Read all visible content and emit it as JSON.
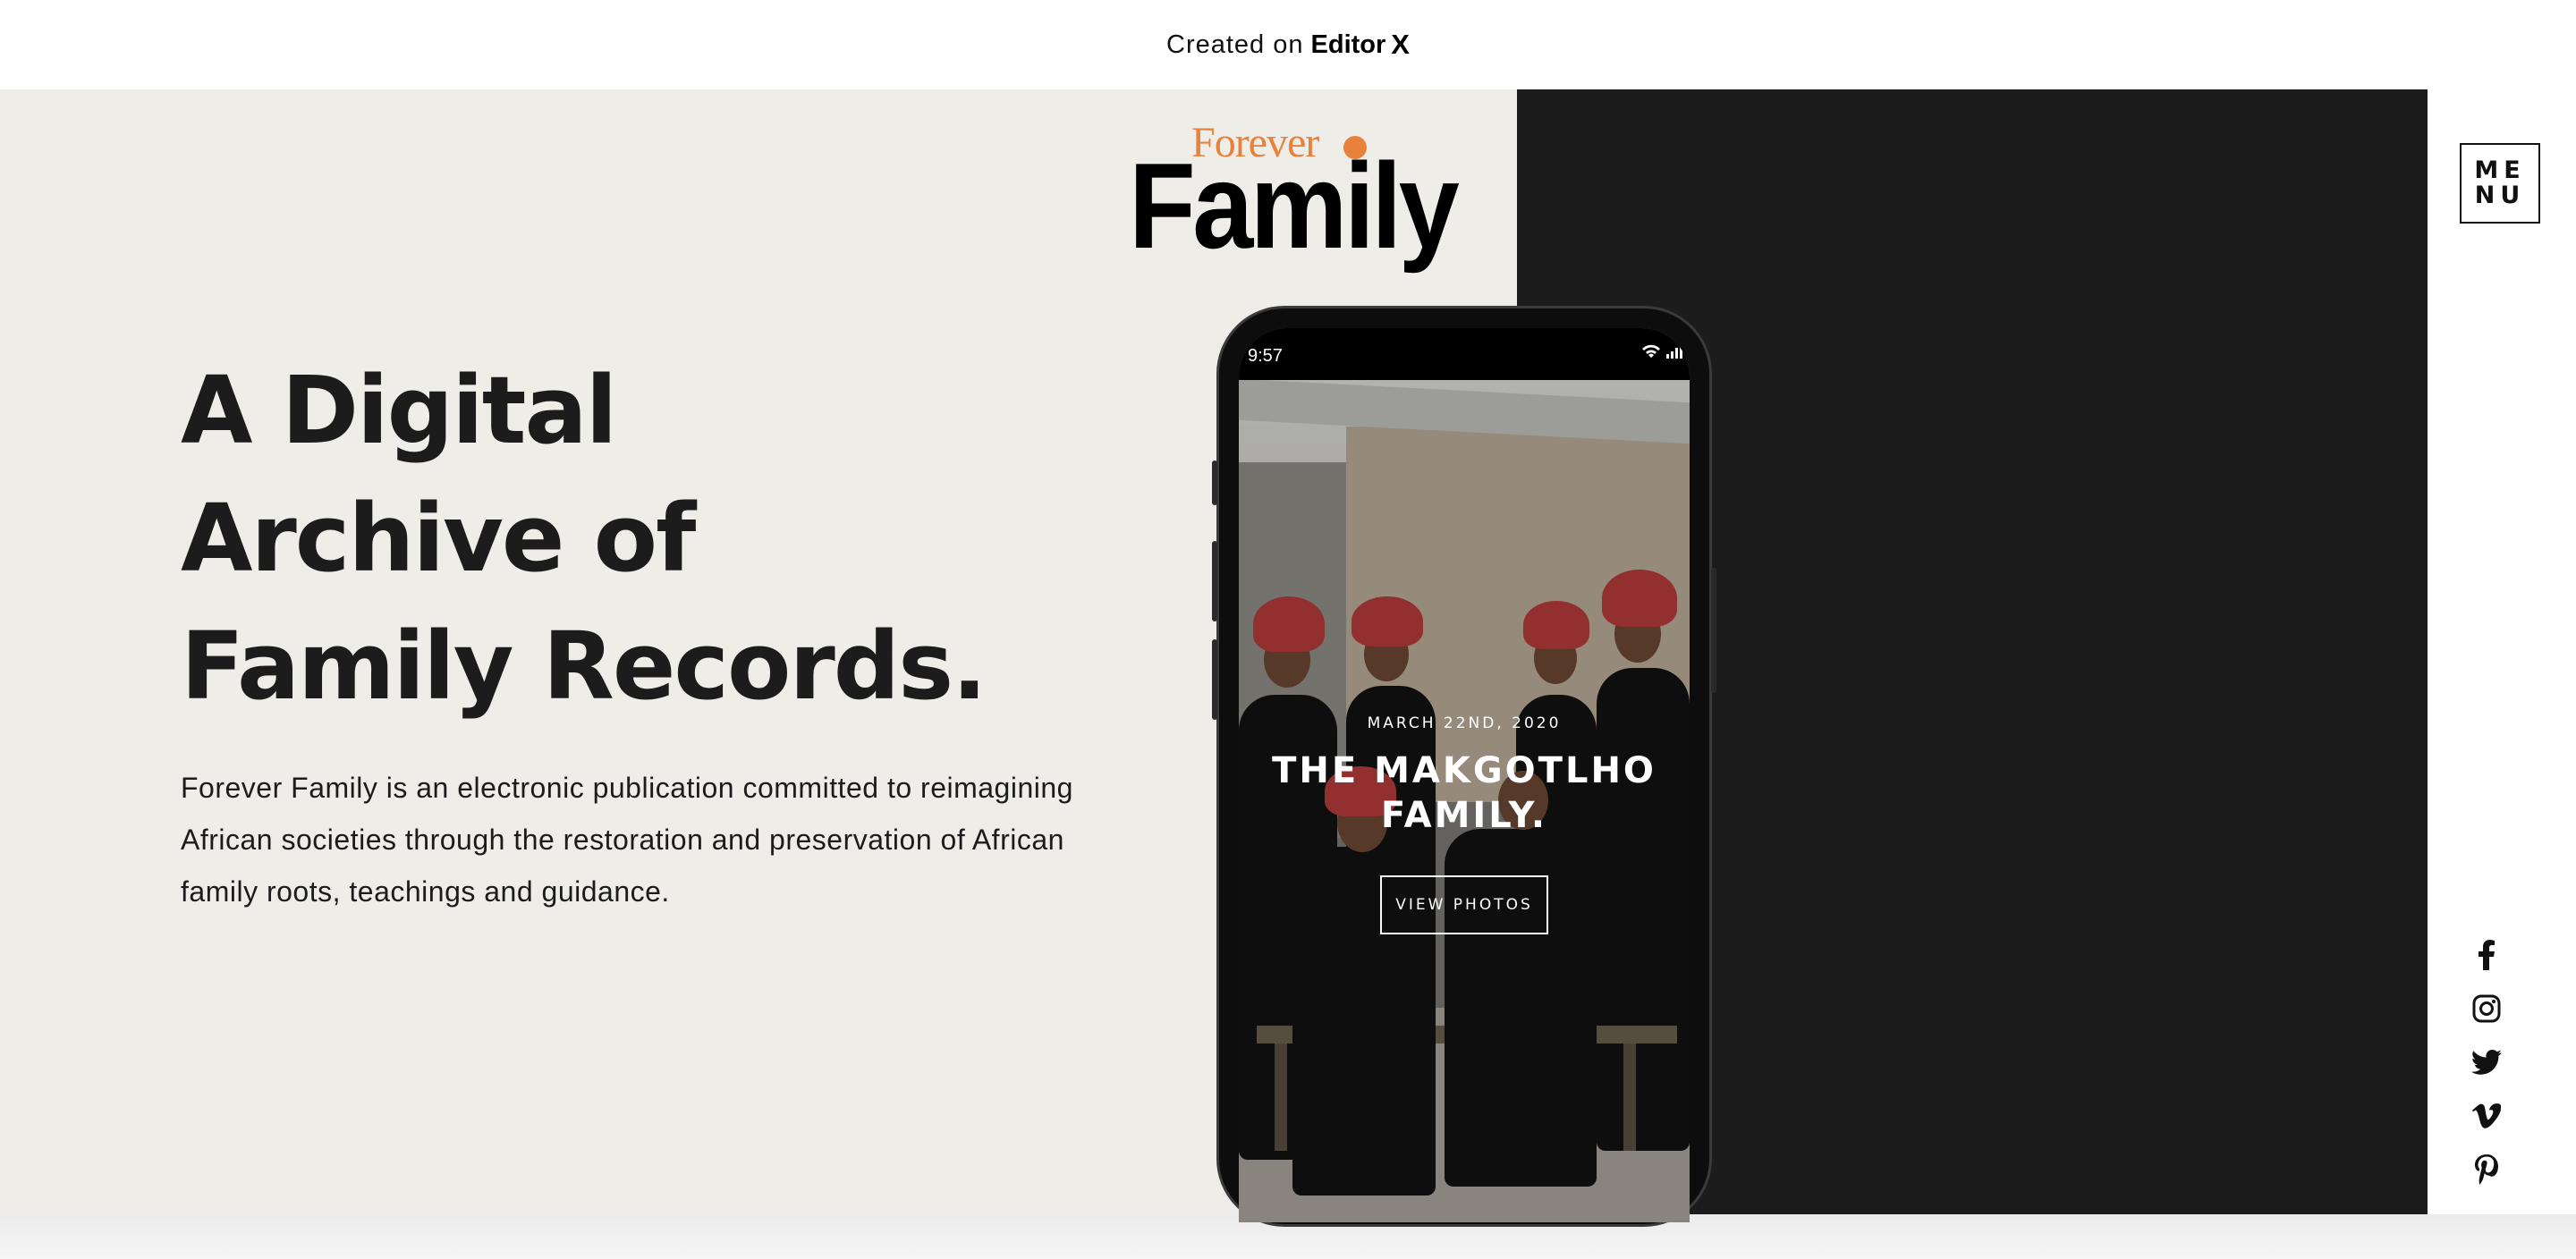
{
  "topbar": {
    "created_label": "Created on",
    "editor_label": "Editor",
    "editor_mark": "X"
  },
  "logo": {
    "line1": "Forever",
    "line2": "Family"
  },
  "hero": {
    "headline_lines": [
      "A Digital",
      "Archive of",
      "Family Records."
    ],
    "lede": "Forever Family is an electronic publication committed to reimagining African societies through the restoration and preservation of African family roots, teachings and guidance."
  },
  "menu": {
    "line1": "ME",
    "line2": "NU"
  },
  "phone": {
    "status_time": "9:57",
    "story_date": "MARCH 22ND, 2020",
    "story_title_line1": "THE MAKGOTLHO",
    "story_title_line2": "FAMILY.",
    "cta_label": "VIEW PHOTOS"
  },
  "social": [
    "facebook-icon",
    "instagram-icon",
    "twitter-icon",
    "vimeo-icon",
    "pinterest-icon"
  ],
  "colors": {
    "hero_background": "#efede8",
    "dark_panel": "#1c1c1c",
    "logo_accent": "#e8823a",
    "text": "#1c1c1c"
  }
}
